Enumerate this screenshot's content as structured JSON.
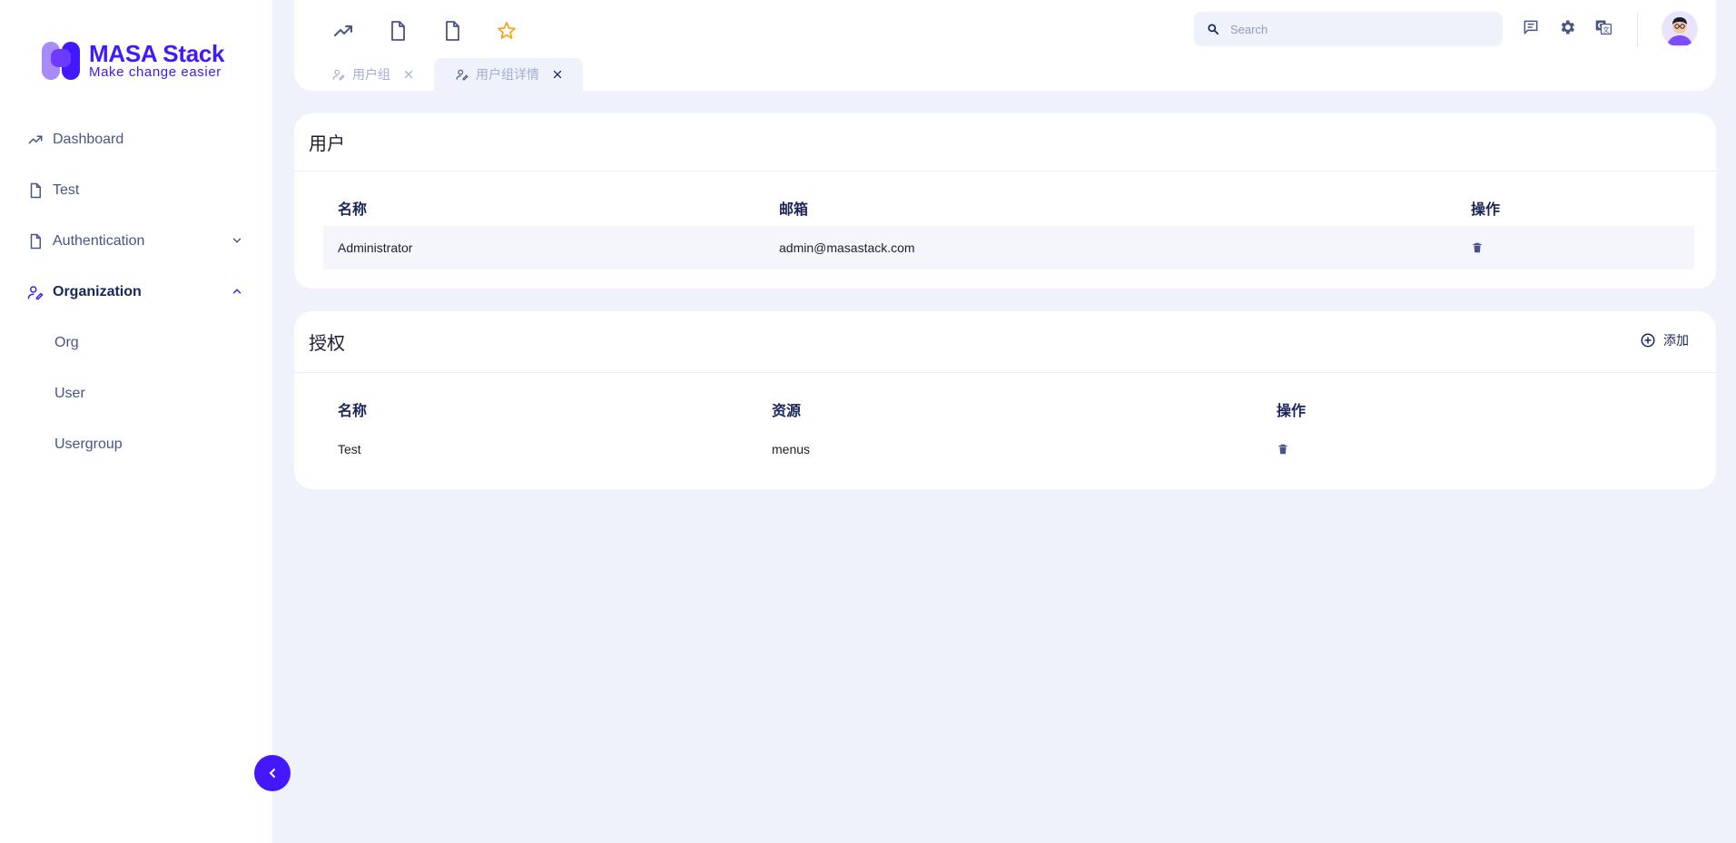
{
  "brand": {
    "name": "MASA Stack",
    "tagline": "Make change easier",
    "color": "#4318ff"
  },
  "sidebar": {
    "items": [
      {
        "label": "Dashboard",
        "icon": "trending-up-icon"
      },
      {
        "label": "Test",
        "icon": "file-icon"
      },
      {
        "label": "Authentication",
        "icon": "file-icon",
        "expandable": true,
        "expanded": false
      },
      {
        "label": "Organization",
        "icon": "user-edit-icon",
        "expandable": true,
        "expanded": true,
        "active": true
      }
    ],
    "sub_items": [
      {
        "label": "Org"
      },
      {
        "label": "User"
      },
      {
        "label": "Usergroup"
      }
    ]
  },
  "topbar": {
    "quick_icons": [
      "trending-up-icon",
      "file-icon",
      "file-icon",
      "star-icon"
    ],
    "search_placeholder": "Search",
    "tool_icons": [
      "message-icon",
      "gear-icon",
      "translate-icon"
    ],
    "tabs": [
      {
        "label": "用户组",
        "active": false
      },
      {
        "label": "用户组详情",
        "active": true
      }
    ]
  },
  "users_card": {
    "title": "用户",
    "columns": [
      "名称",
      "邮箱",
      "操作"
    ],
    "rows": [
      {
        "name": "Administrator",
        "email": "admin@masastack.com"
      }
    ]
  },
  "auth_card": {
    "title": "授权",
    "add_label": "添加",
    "columns": [
      "名称",
      "资源",
      "操作"
    ],
    "rows": [
      {
        "name": "Test",
        "resource": "menus"
      }
    ]
  },
  "colors": {
    "accent": "#4318ff",
    "background": "#eff2fa",
    "star": "#f5a623",
    "text_muted": "#485585"
  }
}
